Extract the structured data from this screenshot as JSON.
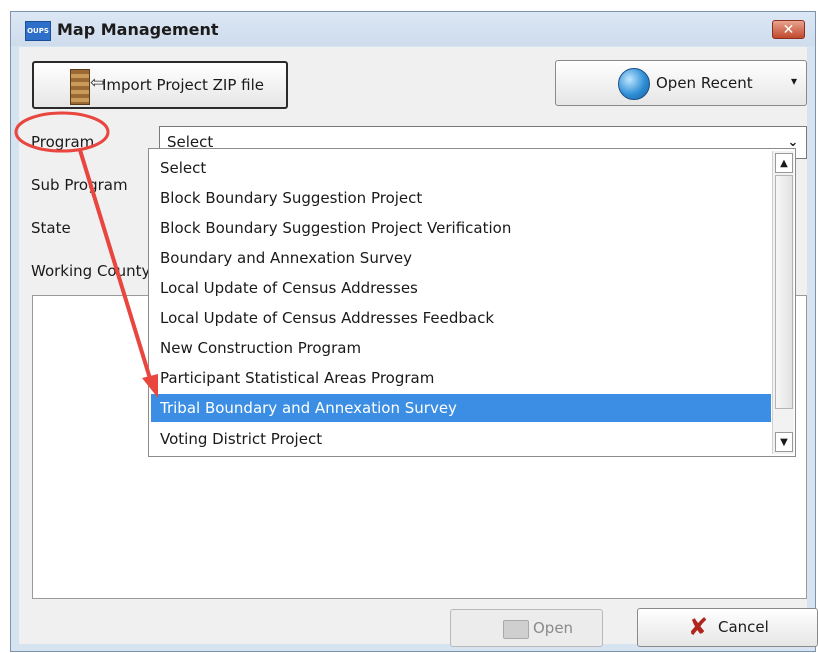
{
  "window": {
    "icon_text": "OUPS",
    "title": "Map Management",
    "close_glyph": "✕"
  },
  "toolbar": {
    "import_label": "Import Project ZIP file",
    "open_recent_label": "Open Recent",
    "open_recent_caret": "▾"
  },
  "form": {
    "labels": {
      "program": "Program",
      "sub_program": "Sub Program",
      "state": "State",
      "working_county": "Working County"
    },
    "program_select": {
      "value": "Select",
      "caret": "⌄"
    }
  },
  "dropdown": {
    "options": [
      "Select",
      "Block Boundary Suggestion Project",
      "Block Boundary Suggestion Project Verification",
      "Boundary and Annexation Survey",
      "Local Update of Census Addresses",
      "Local Update of Census Addresses Feedback",
      "New Construction Program",
      "Participant Statistical Areas Program",
      "Tribal Boundary and Annexation Survey",
      "Voting District Project"
    ],
    "highlighted_option": "Tribal Boundary and Annexation Survey",
    "scroll_up_glyph": "▲",
    "scroll_down_glyph": "▼"
  },
  "footer": {
    "open_label": "Open",
    "cancel_label": "Cancel",
    "cancel_glyph": "✘"
  },
  "icons": {
    "app": "oups-app-icon",
    "import": "zip-file-icon",
    "open_recent": "globe-icon",
    "open": "folder-icon",
    "cancel": "red-x-icon"
  },
  "colors": {
    "highlight": "#3b8ee3",
    "annotation": "#e8463e",
    "title_bar": "#d6e3f1"
  }
}
